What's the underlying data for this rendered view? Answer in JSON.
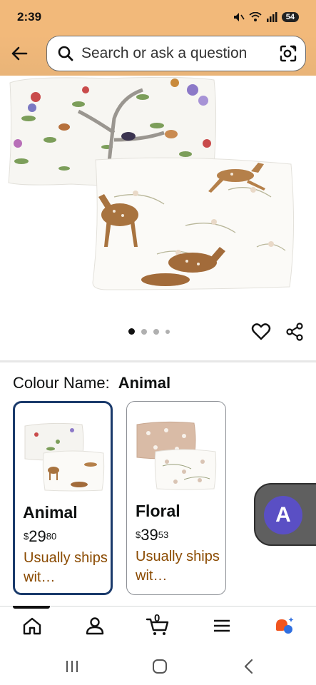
{
  "status": {
    "time": "2:39",
    "battery": "54"
  },
  "search": {
    "placeholder": "Search or ask a question"
  },
  "colour": {
    "label": "Colour Name:",
    "value": "Animal"
  },
  "swatches": [
    {
      "name": "Animal",
      "price_currency": "$",
      "price_whole": "29",
      "price_fraction": "80",
      "shipping": "Usually ships wit…",
      "selected": true
    },
    {
      "name": "Floral",
      "price_currency": "$",
      "price_whole": "39",
      "price_fraction": "53",
      "shipping": "Usually ships wit…",
      "selected": false
    }
  ],
  "carousel": {
    "total_images": 4,
    "active_index": 0
  },
  "bottom_nav": {
    "cart_count": "0",
    "items": [
      "home-icon",
      "account-icon",
      "cart-icon",
      "menu-icon",
      "rufus-icon"
    ]
  },
  "assistant": {
    "letter": "A"
  },
  "colors": {
    "header_orange": "#f2b97a",
    "selected_border": "#1a3a6b",
    "shipping_text": "#8a4a00",
    "assistant_purple": "#5a4fc4"
  }
}
